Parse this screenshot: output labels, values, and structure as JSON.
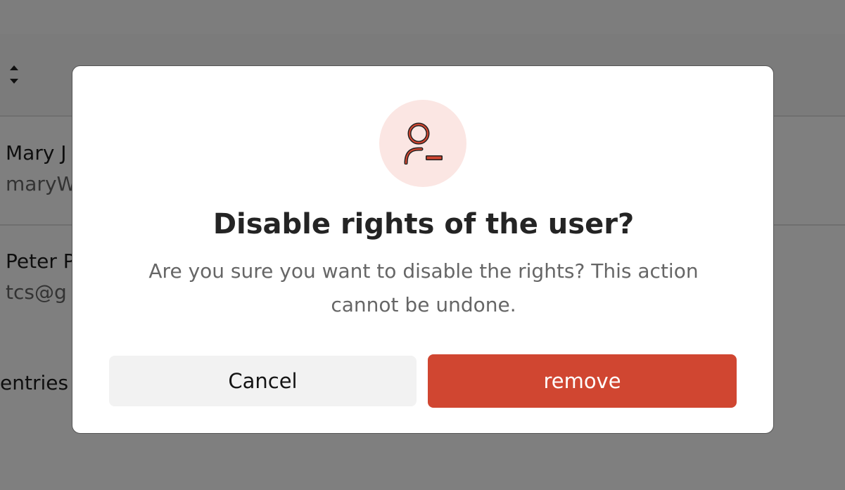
{
  "background": {
    "rows": [
      {
        "name": "Mary J",
        "email": "maryW"
      },
      {
        "name": "Peter P",
        "email": "tcs@g"
      }
    ],
    "footer_text": "entries"
  },
  "dialog": {
    "icon": "user-remove-icon",
    "title": "Disable rights of the user?",
    "message": "Are you sure you want to disable the rights? This action cannot be undone.",
    "cancel_label": "Cancel",
    "confirm_label": "remove",
    "colors": {
      "accent": "#d04631",
      "icon_bg": "#fbe6e3",
      "cancel_bg": "#f2f2f2"
    }
  }
}
